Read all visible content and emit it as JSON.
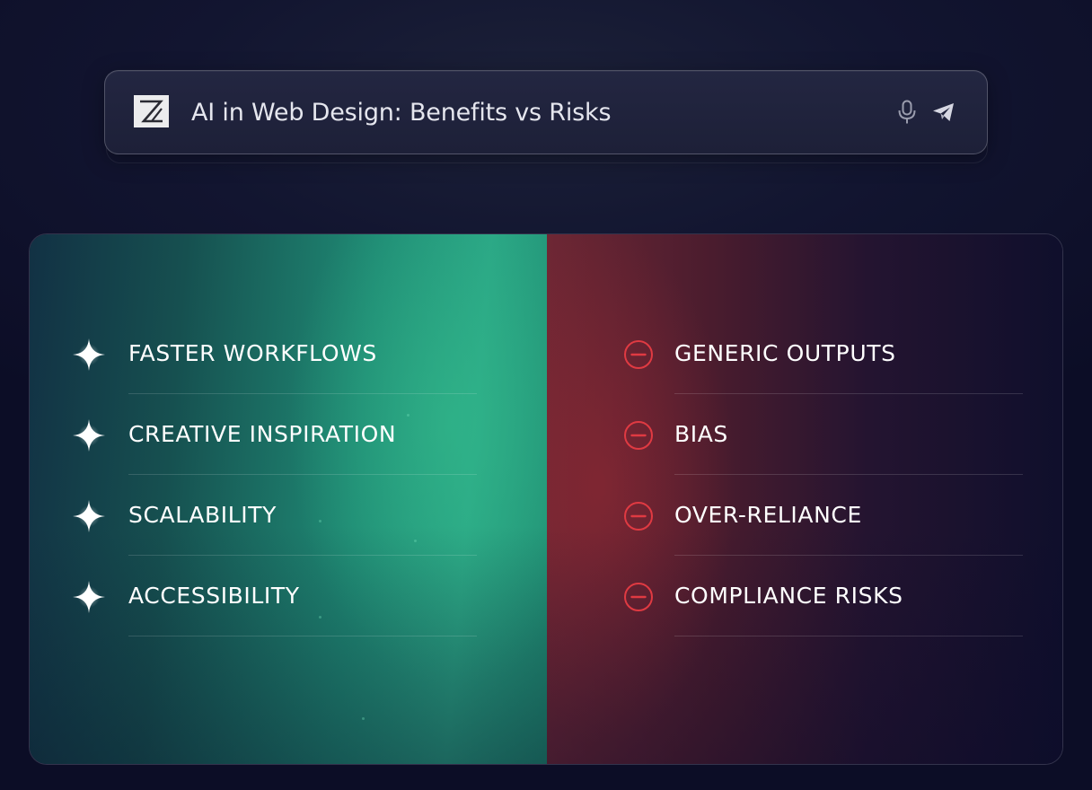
{
  "search": {
    "query": "AI in Web Design: Benefits vs Risks",
    "logo_icon": "z-logo-icon",
    "mic_icon": "microphone-icon",
    "send_icon": "send-icon"
  },
  "benefits": {
    "icon": "sparkle-icon",
    "items": [
      {
        "label": "FASTER WORKFLOWS"
      },
      {
        "label": "CREATIVE INSPIRATION"
      },
      {
        "label": "SCALABILITY"
      },
      {
        "label": "ACCESSIBILITY"
      }
    ]
  },
  "risks": {
    "icon": "minus-circle-icon",
    "items": [
      {
        "label": "GENERIC OUTPUTS"
      },
      {
        "label": "BIAS"
      },
      {
        "label": "OVER-RELIANCE"
      },
      {
        "label": "COMPLIANCE RISKS"
      }
    ]
  },
  "colors": {
    "benefit_accent": "#2aa585",
    "risk_accent": "#e03a42"
  }
}
